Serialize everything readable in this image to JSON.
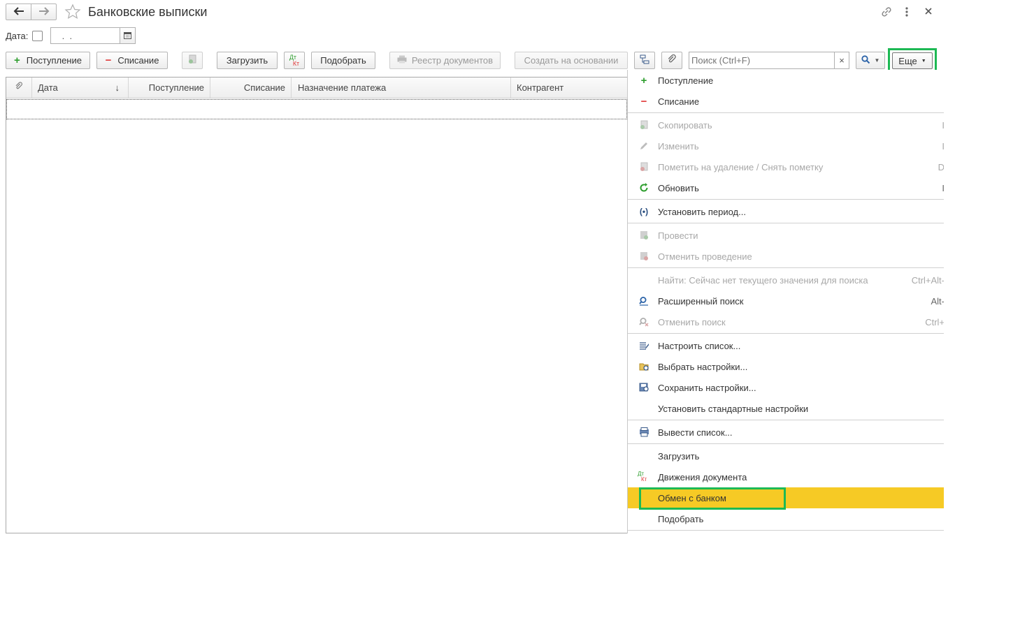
{
  "window": {
    "title": "Банковские выписки",
    "back_icon": "arrow-left-icon",
    "forward_icon": "arrow-right-icon",
    "favorite_icon": "star-icon",
    "link_icon": "link-icon",
    "more_icon": "kebab-icon",
    "close_icon": "close-icon"
  },
  "filter": {
    "date_label": "Дата:",
    "date_value": " .  .  "
  },
  "toolbar": {
    "income": "Поступление",
    "expense": "Списание",
    "load": "Загрузить",
    "dtkt_top": "Дт",
    "dtkt_bottom": "Кт",
    "select": "Подобрать",
    "registry": "Реестр документов",
    "create_based": "Создать на основании",
    "search_placeholder": "Поиск (Ctrl+F)",
    "search_clear": "×",
    "more": "Еще"
  },
  "table": {
    "columns": [
      "",
      "Дата",
      "Поступление",
      "Списание",
      "Назначение платежа",
      "Контрагент"
    ],
    "rows": []
  },
  "menu": {
    "items": [
      {
        "label": "Поступление",
        "icon": "plus-icon",
        "shortcut": "",
        "disabled": false
      },
      {
        "label": "Списание",
        "icon": "minus-icon",
        "shortcut": "",
        "disabled": false
      },
      {
        "label": "Скопировать",
        "icon": "copy-icon",
        "shortcut": "I",
        "disabled": true
      },
      {
        "label": "Изменить",
        "icon": "pencil-icon",
        "shortcut": "I",
        "disabled": true
      },
      {
        "label": "Пометить на удаление / Снять пометку",
        "icon": "delete-mark-icon",
        "shortcut": "D",
        "disabled": true
      },
      {
        "label": "Обновить",
        "icon": "refresh-icon",
        "shortcut": "I",
        "disabled": false
      },
      {
        "label": "Установить период...",
        "icon": "period-icon",
        "shortcut": "",
        "disabled": false
      },
      {
        "label": "Провести",
        "icon": "post-icon",
        "shortcut": "",
        "disabled": true
      },
      {
        "label": "Отменить проведение",
        "icon": "unpost-icon",
        "shortcut": "",
        "disabled": true
      },
      {
        "label": "Найти: Сейчас нет текущего значения для поиска",
        "icon": "",
        "shortcut": "Ctrl+Alt-",
        "disabled": true
      },
      {
        "label": "Расширенный поиск",
        "icon": "search-icon",
        "shortcut": "Alt-",
        "disabled": false
      },
      {
        "label": "Отменить поиск",
        "icon": "cancel-search-icon",
        "shortcut": "Ctrl+",
        "disabled": true
      },
      {
        "label": "Настроить список...",
        "icon": "list-settings-icon",
        "shortcut": "",
        "disabled": false
      },
      {
        "label": "Выбрать настройки...",
        "icon": "folder-settings-icon",
        "shortcut": "",
        "disabled": false
      },
      {
        "label": "Сохранить настройки...",
        "icon": "save-settings-icon",
        "shortcut": "",
        "disabled": false
      },
      {
        "label": "Установить стандартные настройки",
        "icon": "",
        "shortcut": "",
        "disabled": false
      },
      {
        "label": "Вывести список...",
        "icon": "print-list-icon",
        "shortcut": "",
        "disabled": false
      },
      {
        "label": "Загрузить",
        "icon": "",
        "shortcut": "",
        "disabled": false
      },
      {
        "label": "Движения документа",
        "icon": "dtkt-icon",
        "shortcut": "",
        "disabled": false
      },
      {
        "label": "Обмен с банком",
        "icon": "",
        "shortcut": "",
        "disabled": false,
        "highlighted": true
      },
      {
        "label": "Подобрать",
        "icon": "",
        "shortcut": "",
        "disabled": false
      }
    ]
  },
  "colors": {
    "highlight": "#f6ca25",
    "annotation_box": "#1db954",
    "plus": "#2e9e2e",
    "minus": "#e03a3a"
  }
}
